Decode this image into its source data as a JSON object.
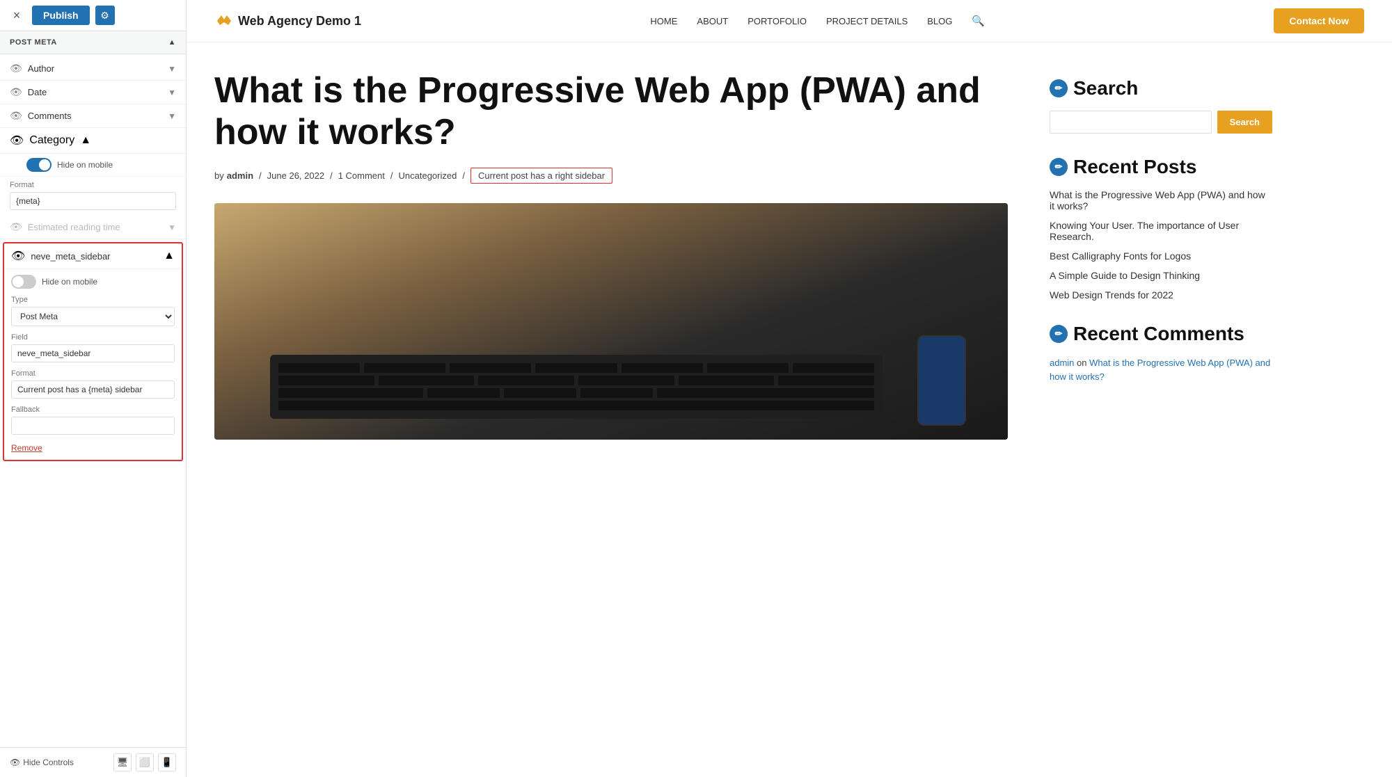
{
  "topbar": {
    "close_label": "×",
    "publish_label": "Publish",
    "settings_icon": "⚙"
  },
  "left_panel": {
    "section_title": "POST META",
    "meta_items": [
      {
        "id": "author",
        "label": "Author",
        "visible": true,
        "expanded": false
      },
      {
        "id": "date",
        "label": "Date",
        "visible": true,
        "expanded": false
      },
      {
        "id": "comments",
        "label": "Comments",
        "visible": true,
        "expanded": false
      },
      {
        "id": "category",
        "label": "Category",
        "visible": true,
        "expanded": true
      }
    ],
    "category": {
      "hide_on_mobile_label": "Hide on mobile",
      "toggle_on": true,
      "format_label": "Format",
      "format_value": "{meta}"
    },
    "estimated_reading": {
      "label": "Estimated reading time",
      "visible": false
    },
    "neve_sidebar": {
      "label": "neve_meta_sidebar",
      "visible": true,
      "expanded": true,
      "hide_on_mobile_label": "Hide on mobile",
      "toggle_on": false,
      "type_label": "Type",
      "type_value": "Post Meta",
      "field_label": "Field",
      "field_value": "neve_meta_sidebar",
      "format_label": "Format",
      "format_value": "Current post has a {meta} sidebar",
      "fallback_label": "Fallback",
      "fallback_value": "",
      "remove_label": "Remove"
    },
    "bottom": {
      "hide_controls_label": "Hide Controls",
      "desktop_icon": "🖥",
      "tablet_icon": "⬜",
      "mobile_icon": "📱"
    }
  },
  "site_header": {
    "logo_text": "Web Agency Demo 1",
    "nav_items": [
      "HOME",
      "ABOUT",
      "PORTOFOLIO",
      "PROJECT DETAILS",
      "BLOG"
    ],
    "contact_btn": "Contact Now"
  },
  "article": {
    "title": "What is the Progressive Web App (PWA) and how it works?",
    "meta": {
      "by": "by",
      "author": "admin",
      "date": "June 26, 2022",
      "comments": "1 Comment",
      "category": "Uncategorized",
      "sidebar_badge": "Current post has a right sidebar"
    }
  },
  "sidebar": {
    "search_title": "Search",
    "search_placeholder": "",
    "search_btn": "Search",
    "recent_posts_title": "Recent Posts",
    "recent_posts": [
      "What is the Progressive Web App (PWA) and how it works?",
      "Knowing Your User. The importance of User Research.",
      "Best Calligraphy Fonts for Logos",
      "A Simple Guide to Design Thinking",
      "Web Design Trends for 2022"
    ],
    "recent_comments_title": "Recent Comments",
    "recent_comments_author": "admin",
    "recent_comments_on": "on",
    "recent_comments_post": "What is the Progressive Web App (PWA) and how it works?"
  }
}
